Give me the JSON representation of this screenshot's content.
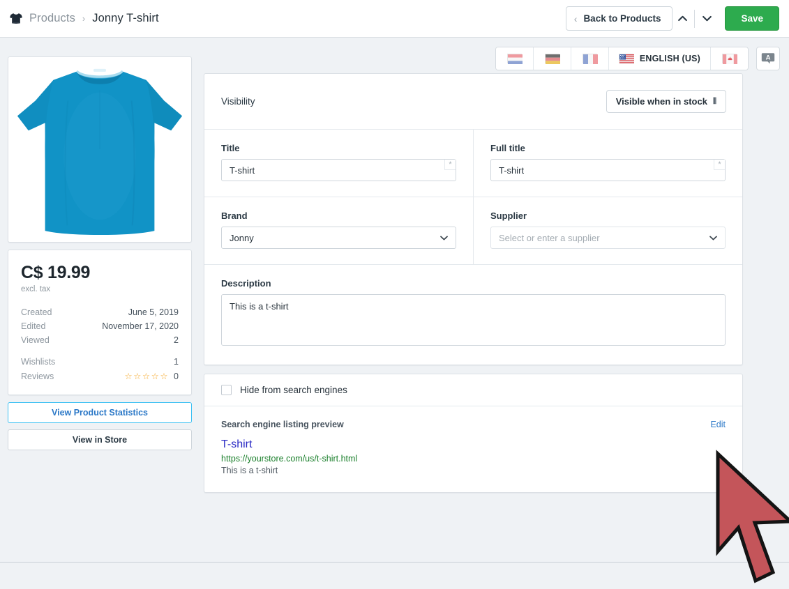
{
  "breadcrumb": {
    "icon": "tshirt-icon",
    "parent": "Products",
    "separator": "›",
    "current": "Jonny T-shirt"
  },
  "topbar": {
    "back_label": "Back to Products",
    "back_chevron": "‹",
    "prev_icon": "chevron-up-icon",
    "next_icon": "chevron-down-icon",
    "prev_glyph": "⌃",
    "next_glyph": "⌄",
    "save_label": "Save",
    "save_color": "#2dab4e"
  },
  "languages": {
    "items": [
      {
        "name": "dutch",
        "flag": "nl",
        "label": "",
        "active": false
      },
      {
        "name": "german",
        "flag": "de",
        "label": "",
        "active": false
      },
      {
        "name": "french",
        "flag": "fr",
        "label": "",
        "active": false
      },
      {
        "name": "english-us",
        "flag": "us",
        "label": "ENGLISH (US)",
        "active": true
      },
      {
        "name": "canadian",
        "flag": "ca",
        "label": "",
        "active": false
      }
    ],
    "translate_icon": "translate-icon",
    "translate_glyph": "A"
  },
  "product_image": {
    "alt": "blue t-shirt",
    "color": "#1193c6"
  },
  "info": {
    "price": "C$ 19.99",
    "tax_note": "excl. tax",
    "rows": [
      {
        "key": "Created",
        "value": "June 5, 2019"
      },
      {
        "key": "Edited",
        "value": "November 17, 2020"
      },
      {
        "key": "Viewed",
        "value": "2"
      }
    ],
    "rows2": [
      {
        "key": "Wishlists",
        "value": "1"
      },
      {
        "key": "Reviews",
        "value": "0",
        "stars": "☆☆☆☆☆"
      }
    ],
    "stars_color": "#f5a623",
    "view_stats_label": "View Product Statistics",
    "view_store_label": "View in Store"
  },
  "form": {
    "visibility_label": "Visibility",
    "visibility_value": "Visible when in stock",
    "visibility_caret": "⫴",
    "title_label": "Title",
    "title_value": "T-shirt",
    "title_required": "*",
    "full_title_label": "Full title",
    "full_title_value": "T-shirt",
    "full_title_required": "*",
    "brand_label": "Brand",
    "brand_value": "Jonny",
    "supplier_label": "Supplier",
    "supplier_placeholder": "Select or enter a supplier",
    "caret_glyph": "⌄",
    "description_label": "Description",
    "description_value": "This is a t-shirt"
  },
  "seo": {
    "hide_label": "Hide from search engines",
    "hide_checked": false,
    "preview_label": "Search engine listing preview",
    "edit_label": "Edit",
    "g_title": "T-shirt",
    "g_url": "https://yourstore.com/us/t-shirt.html",
    "g_desc": "This is a t-shirt"
  },
  "cursor": {
    "name": "mouse-cursor",
    "fill": "#c4555a",
    "stroke": "#1a1a1a"
  }
}
